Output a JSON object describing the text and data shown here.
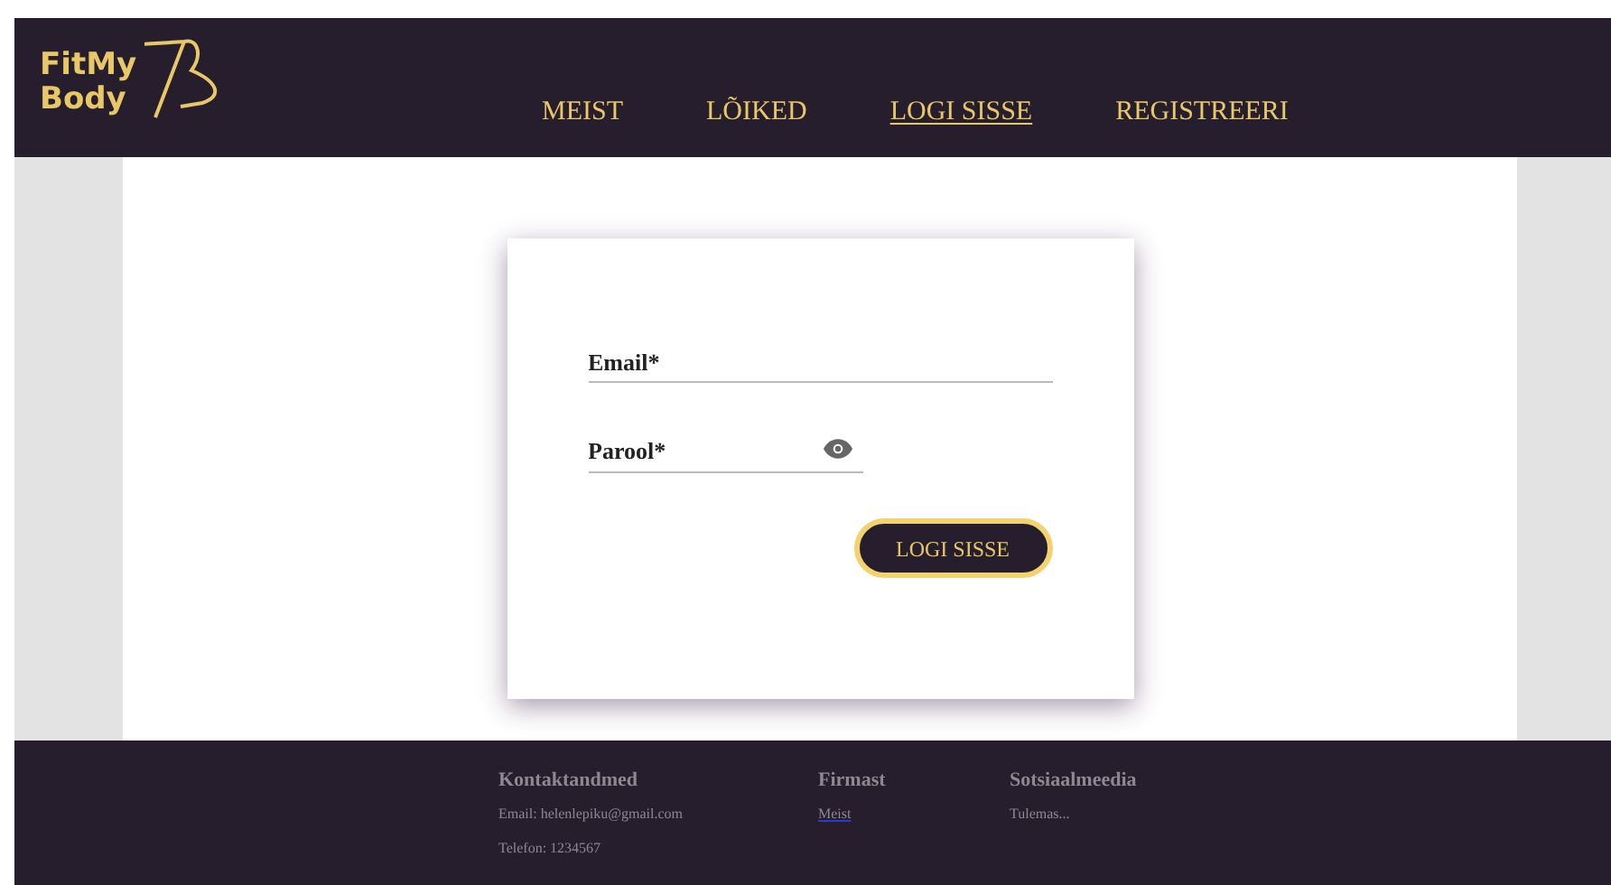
{
  "logo": {
    "line_1": "FitMy",
    "line_2": "Body"
  },
  "nav": [
    {
      "label": "MEIST",
      "selected": false
    },
    {
      "label": "LÕIKED",
      "selected": false
    },
    {
      "label": "LOGI SISSE",
      "selected": true
    },
    {
      "label": "REGISTREERI",
      "selected": false
    }
  ],
  "login_form": {
    "email": {
      "placeholder": "Email*"
    },
    "password": {
      "placeholder": "Parool*"
    },
    "submit": "LOGI SISSE"
  },
  "footer": [
    {
      "heading": "Kontaktandmed",
      "items": [
        {
          "text": "Email: helenlepiku@gmail.com",
          "kind": "text"
        },
        {
          "text": "Telefon: 1234567",
          "kind": "text"
        }
      ]
    },
    {
      "heading": "Firmast",
      "items": [
        {
          "text": "Meist",
          "kind": "link"
        }
      ]
    },
    {
      "heading": "Sotsiaalmeedia",
      "items": [
        {
          "text": "Tulemas...",
          "kind": "text"
        }
      ]
    }
  ]
}
